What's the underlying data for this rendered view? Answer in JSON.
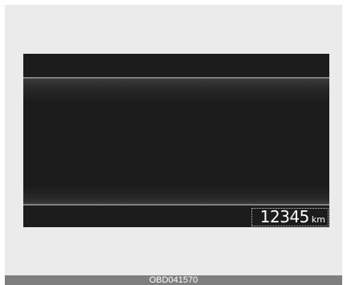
{
  "odometer": {
    "value": "12345",
    "unit": "km"
  },
  "caption": {
    "code": "OBD041570"
  }
}
